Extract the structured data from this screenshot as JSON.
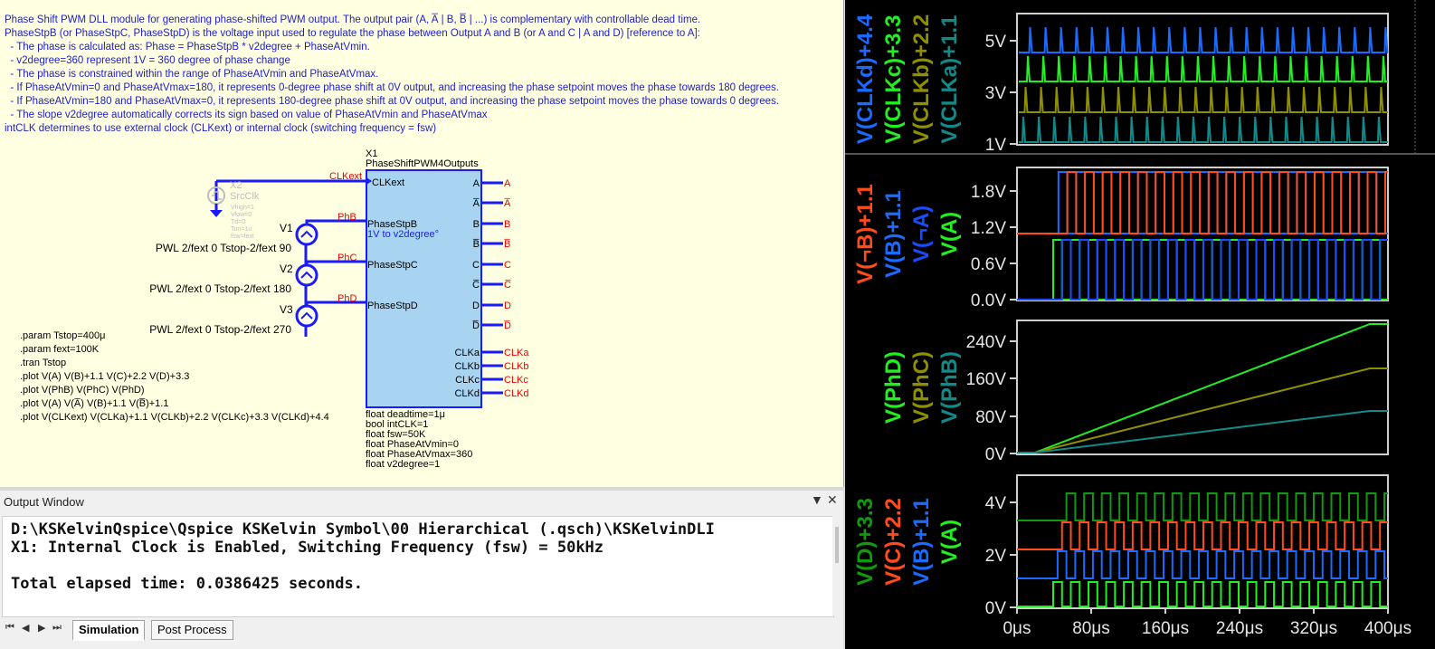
{
  "schematic": {
    "description_lines": [
      "Phase Shift PWM DLL module for generating phase-shifted PWM output. The output pair (A, A̅ | B, B̅ | ...) is complementary with controllable dead time.",
      "PhaseStpB (or PhaseStpC, PhaseStpD) is the voltage input used to regulate the phase between Output A and B (or A and C | A and D) [reference to A]:",
      "  - The phase is calculated as: Phase = PhaseStpB * v2degree + PhaseAtVmin.",
      "  - v2degree=360 represent 1V = 360 degree of phase change",
      "  - The phase is constrained within the range of PhaseAtVmin and PhaseAtVmax.",
      "  - If PhaseAtVmin=0 and PhaseAtVmax=180, it represents 0-degree phase shift at 0V output, and increasing the phase setpoint moves the phase towards 180 degrees.",
      "  - If PhaseAtVmin=180 and PhaseAtVmax=0, it represents 180-degree phase shift at 0V output, and increasing the phase setpoint moves the phase towards 0 degrees.",
      "  - The slope v2degree automatically corrects its sign based on value of PhaseAtVmin and PhaseAtVmax",
      "intCLK determines to use external clock (CLKext) or internal clock (switching frequency = fsw)"
    ],
    "block": {
      "instance": "X1",
      "type": "PhaseShiftPWM4Outputs",
      "inputs": [
        "CLKext",
        "PhaseStpB",
        "PhaseStpC",
        "PhaseStpD"
      ],
      "subnote": "1V to v2degree°",
      "outputs": [
        "A",
        "A̅",
        "B",
        "B̅",
        "C",
        "C̅",
        "D",
        "D̅"
      ],
      "clk_outputs": [
        "CLKa",
        "CLKb",
        "CLKc",
        "CLKd"
      ],
      "params": [
        "float deadtime=1μ",
        "bool intCLK=1",
        "float fsw=50K",
        "float PhaseAtVmin=0",
        "float PhaseAtVmax=360",
        "float v2degree=1"
      ]
    },
    "netlabels": {
      "clkext": "CLKext",
      "phb": "PhB",
      "phc": "PhC",
      "phd": "PhD"
    },
    "srcclk": {
      "name": "X2",
      "type": "SrcClk",
      "params": [
        "Vhigh=1",
        "Vlow=0",
        "Td=0",
        "Ton=1u",
        "fsw=fext"
      ]
    },
    "sources": [
      {
        "name": "V1",
        "pwl": "PWL 2/fext 0 Tstop-2/fext 90"
      },
      {
        "name": "V2",
        "pwl": "PWL 2/fext 0 Tstop-2/fext 180"
      },
      {
        "name": "V3",
        "pwl": "PWL 2/fext 0 Tstop-2/fext 270"
      }
    ],
    "directives": [
      ".param Tstop=400μ",
      ".param fext=100K",
      ".tran Tstop",
      ".plot V(A) V(B)+1.1 V(C)+2.2 V(D)+3.3",
      ".plot V(PhB) V(PhC) V(PhD)",
      ".plot V(A) V(A̅) V(B)+1.1 V(B̅)+1.1",
      ".plot V(CLKext) V(CLKa)+1.1 V(CLKb)+2.2 V(CLKc)+3.3 V(CLKd)+4.4"
    ]
  },
  "output_window": {
    "title": "Output Window",
    "pin_glyph": "▼",
    "close_glyph": "✕",
    "lines": [
      "D:\\KSKelvinQspice\\Qspice KSKelvin Symbol\\00 Hierarchical (.qsch)\\KSKelvinDLI",
      "X1: Internal Clock is Enabled, Switching Frequency (fsw) = 50kHz",
      "",
      "Total elapsed time: 0.0386425 seconds."
    ]
  },
  "tabs": {
    "nav": [
      "⏮",
      "◀",
      "▶",
      "⏭"
    ],
    "items": [
      "Simulation",
      "Post Process"
    ],
    "active": "Simulation"
  },
  "waveform": {
    "x_ticks": [
      "0μs",
      "80μs",
      "160μs",
      "240μs",
      "320μs",
      "400μs"
    ],
    "plots": [
      {
        "id": "clk",
        "y_ticks": [
          "5V",
          "3V",
          "1V"
        ],
        "labels": [
          {
            "text": "V(CLKd)+4.4",
            "color": "#1a6bff"
          },
          {
            "text": "V(CLKc)+3.3",
            "color": "#22ee22"
          },
          {
            "text": "V(CLKb)+2.2",
            "color": "#8f8f00"
          },
          {
            "text": "V(CLKa)+1.1",
            "color": "#138a8a"
          }
        ]
      },
      {
        "id": "comp",
        "y_ticks": [
          "1.8V",
          "1.2V",
          "0.6V",
          "0.0V"
        ],
        "labels": [
          {
            "text": "V(¬B)+1.1",
            "color": "#ff4c1a"
          },
          {
            "text": "V(B)+1.1",
            "color": "#1a6bff"
          },
          {
            "text": "V(¬A)",
            "color": "#1a4bff"
          },
          {
            "text": "V(A)",
            "color": "#22ee22"
          }
        ]
      },
      {
        "id": "phase",
        "y_ticks": [
          "240V",
          "160V",
          "80V",
          "0V"
        ],
        "labels": [
          {
            "text": "V(PhD)",
            "color": "#22ee22"
          },
          {
            "text": "V(PhC)",
            "color": "#8f8f00"
          },
          {
            "text": "V(PhB)",
            "color": "#138a8a"
          }
        ]
      },
      {
        "id": "pwm",
        "y_ticks": [
          "4V",
          "2V",
          "0V"
        ],
        "labels": [
          {
            "text": "V(D)+3.3",
            "color": "#0f9a0f"
          },
          {
            "text": "V(C)+2.2",
            "color": "#ff4c1a"
          },
          {
            "text": "V(B)+1.1",
            "color": "#1a6bff"
          },
          {
            "text": "V(A)",
            "color": "#22ee22"
          }
        ]
      }
    ]
  }
}
